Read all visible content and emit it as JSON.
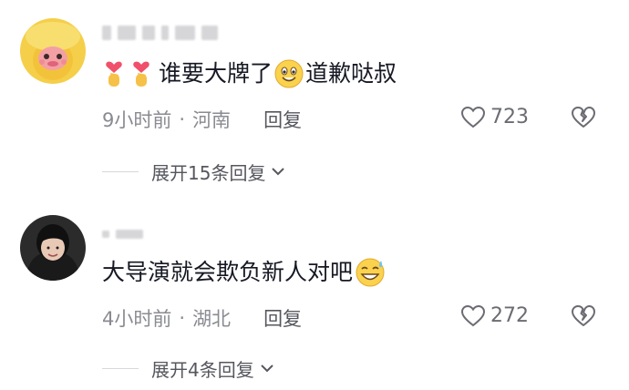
{
  "comments": [
    {
      "username_blurred": "",
      "text_before_emoji": "谁要大牌了",
      "text_after_emoji": "道歉哒叔",
      "time": "9小时前",
      "location": "河南",
      "reply": "回复",
      "likes": "723",
      "expand": "展开15条回复",
      "lead_emojis": [
        "finger-heart-icon",
        "finger-heart-icon"
      ],
      "inline_emoji": "grinning-face-icon"
    },
    {
      "username_blurred": "",
      "text_before_emoji": "大导演就会欺负新人对吧",
      "text_after_emoji": "",
      "time": "4小时前",
      "location": "湖北",
      "reply": "回复",
      "likes": "272",
      "expand": "展开4条回复",
      "lead_emojis": [],
      "inline_emoji": "grinning-sweat-icon"
    }
  ],
  "separator": "·",
  "colors": {
    "text": "#161823",
    "meta": "#8a8b91",
    "reply": "#56575e",
    "accent_yellow": "#f6d65a"
  }
}
